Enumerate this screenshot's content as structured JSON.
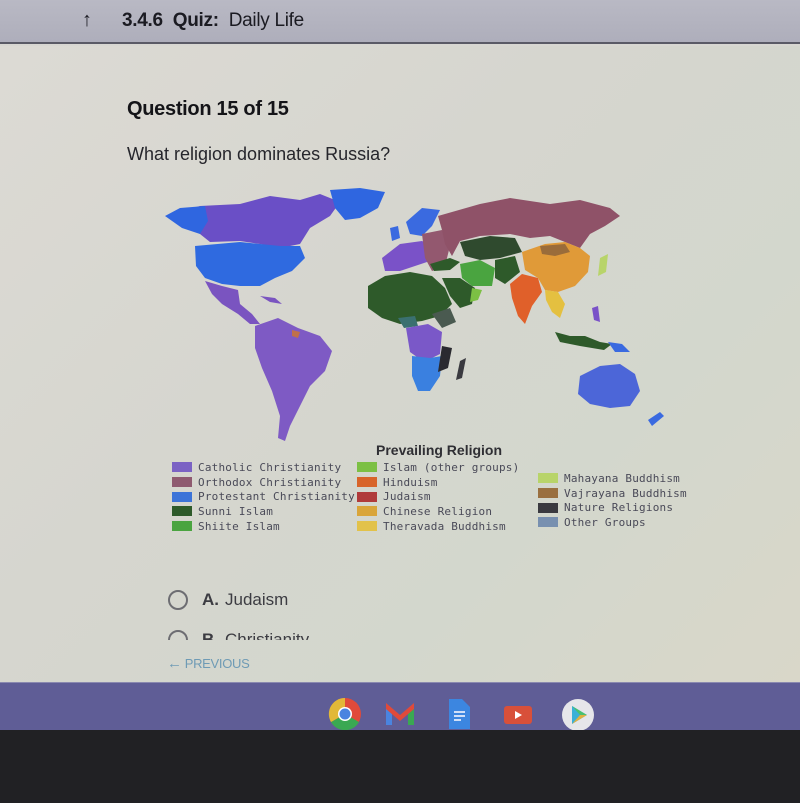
{
  "header": {
    "back_icon": "back-arrow-icon",
    "lesson_number": "3.4.6",
    "lesson_type": "Quiz:",
    "lesson_name": "Daily Life"
  },
  "question": {
    "number_label": "Question 15 of 15",
    "text": "What religion dominates Russia?"
  },
  "map": {
    "title": "Prevailing Religion",
    "legend": [
      {
        "label": "Catholic Christianity",
        "color": "#7b62c4"
      },
      {
        "label": "Orthodox Christianity",
        "color": "#8f5a70"
      },
      {
        "label": "Protestant Christianity",
        "color": "#3c73d8"
      },
      {
        "label": "Sunni Islam",
        "color": "#2e5a2a"
      },
      {
        "label": "Shiite Islam",
        "color": "#4aa440"
      },
      {
        "label": "Islam (other groups)",
        "color": "#7cc044"
      },
      {
        "label": "Hinduism",
        "color": "#d8642a"
      },
      {
        "label": "Judaism",
        "color": "#b03a3a"
      },
      {
        "label": "Chinese Religion",
        "color": "#d9a53a"
      },
      {
        "label": "Theravada Buddhism",
        "color": "#e2c24a"
      },
      {
        "label": "Mahayana Buddhism",
        "color": "#b8d46a"
      },
      {
        "label": "Vajrayana Buddhism",
        "color": "#9a7040"
      },
      {
        "label": "Nature Religions",
        "color": "#3a3a40"
      },
      {
        "label": "Other Groups",
        "color": "#7890b0"
      }
    ]
  },
  "options": [
    {
      "letter": "A.",
      "text": "Judaism"
    },
    {
      "letter": "B.",
      "text": "Christianity"
    }
  ],
  "nav": {
    "previous_label": "PREVIOUS"
  },
  "shelf": {
    "apps": [
      "chrome-icon",
      "gmail-icon",
      "docs-icon",
      "youtube-icon",
      "play-store-icon"
    ]
  }
}
